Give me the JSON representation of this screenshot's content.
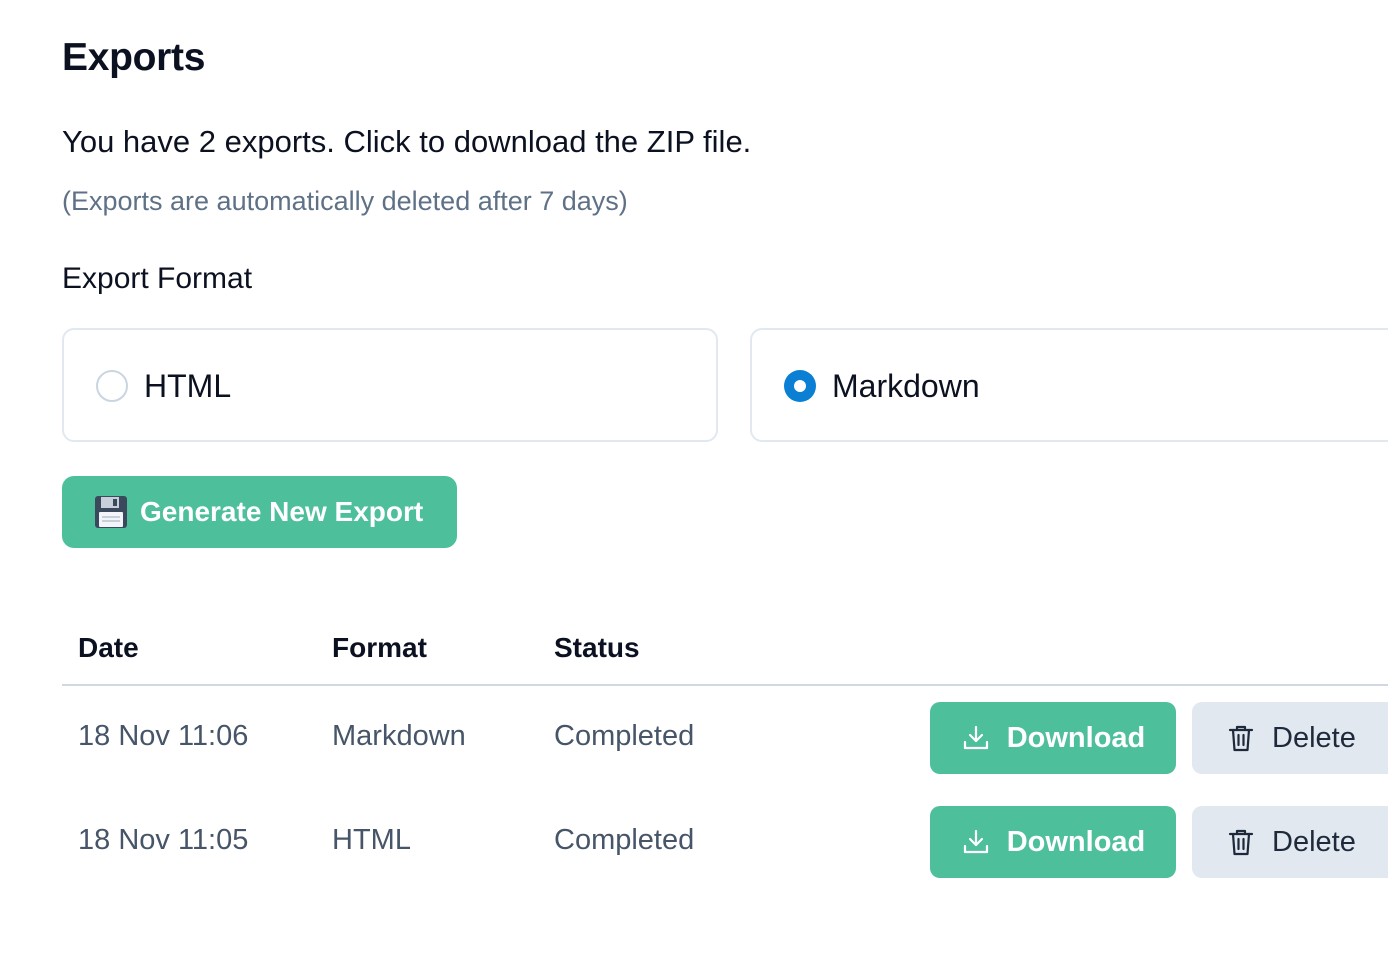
{
  "page": {
    "title": "Exports",
    "subtitle": "You have 2 exports. Click to download the ZIP file.",
    "note": "(Exports are automatically deleted after 7 days)"
  },
  "export_format": {
    "label": "Export Format",
    "options": [
      {
        "label": "HTML",
        "selected": false
      },
      {
        "label": "Markdown",
        "selected": true
      }
    ]
  },
  "generate_button": {
    "label": "Generate New Export",
    "icon": "floppy-disk-icon"
  },
  "table": {
    "headers": [
      "Date",
      "Format",
      "Status"
    ],
    "rows": [
      {
        "date": "18 Nov 11:06",
        "format": "Markdown",
        "status": "Completed",
        "download_label": "Download",
        "delete_label": "Delete"
      },
      {
        "date": "18 Nov 11:05",
        "format": "HTML",
        "status": "Completed",
        "download_label": "Download",
        "delete_label": "Delete"
      }
    ]
  },
  "colors": {
    "accent_green": "#4ebf9b",
    "radio_selected": "#0a7fd3",
    "muted_text": "#5f7186",
    "delete_bg": "#e2e8f0"
  }
}
